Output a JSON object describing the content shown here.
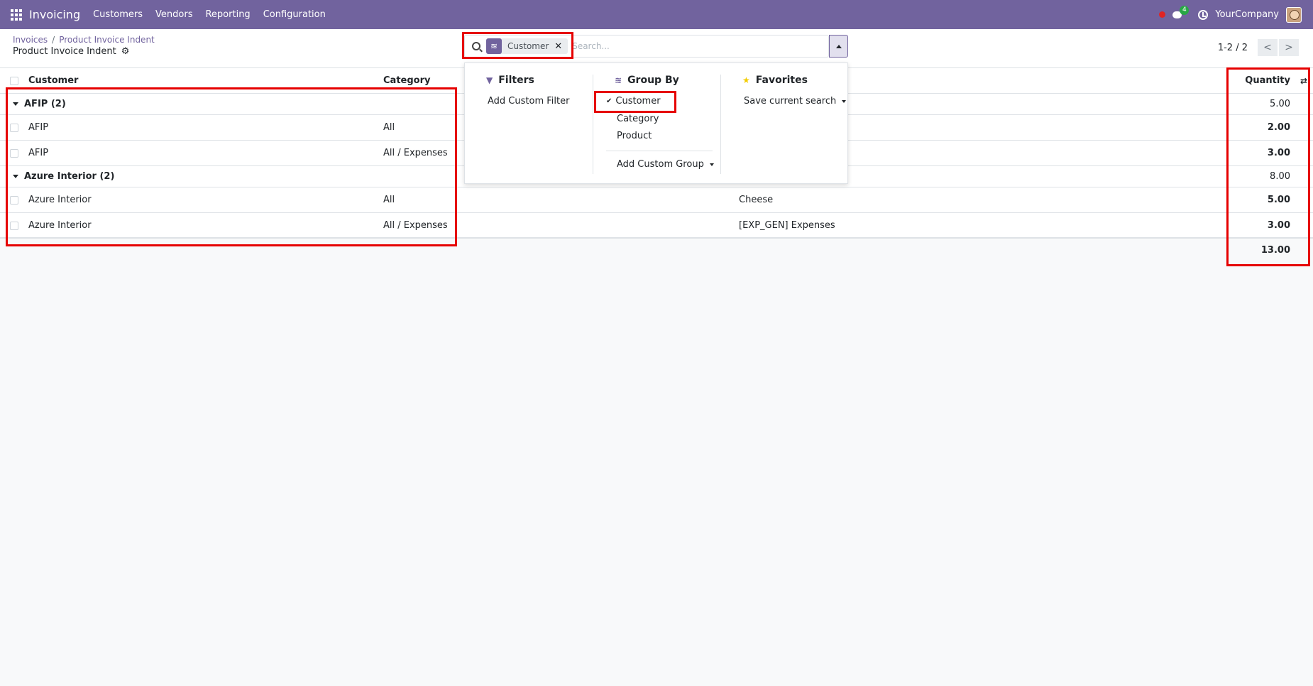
{
  "navbar": {
    "app_name": "Invoicing",
    "menu": [
      "Customers",
      "Vendors",
      "Reporting",
      "Configuration"
    ],
    "chat_badge": "4",
    "company": "YourCompany",
    "bg_color": "#71639e"
  },
  "breadcrumb": {
    "parent": "Invoices",
    "separator": "/",
    "current": "Product Invoice Indent"
  },
  "page_title": "Product Invoice Indent",
  "search": {
    "facet_label": "Customer",
    "placeholder": "Search..."
  },
  "pager": {
    "value": "1-2 / 2",
    "prev": "<",
    "next": ">"
  },
  "table": {
    "headers": {
      "customer": "Customer",
      "category": "Category",
      "quantity": "Quantity"
    },
    "groups": [
      {
        "title": "AFIP (2)",
        "total": "5.00",
        "rows": [
          {
            "customer": "AFIP",
            "category": "All",
            "product": "",
            "quantity": "2.00"
          },
          {
            "customer": "AFIP",
            "category": "All / Expenses",
            "product": "",
            "quantity": "3.00"
          }
        ]
      },
      {
        "title": "Azure Interior (2)",
        "total": "8.00",
        "rows": [
          {
            "customer": "Azure Interior",
            "category": "All",
            "product": "Cheese",
            "quantity": "5.00"
          },
          {
            "customer": "Azure Interior",
            "category": "All / Expenses",
            "product": "[EXP_GEN] Expenses",
            "quantity": "3.00"
          }
        ]
      }
    ],
    "grand_total": "13.00"
  },
  "dropdown": {
    "filters": {
      "title": "Filters",
      "items": [
        "Add Custom Filter"
      ]
    },
    "group_by": {
      "title": "Group By",
      "options": [
        {
          "label": "Customer",
          "checked": true
        },
        {
          "label": "Category",
          "checked": false
        },
        {
          "label": "Product",
          "checked": false
        }
      ],
      "add_custom": "Add Custom Group"
    },
    "favorites": {
      "title": "Favorites",
      "save_label": "Save current search"
    }
  },
  "highlight_color": "#e60000"
}
